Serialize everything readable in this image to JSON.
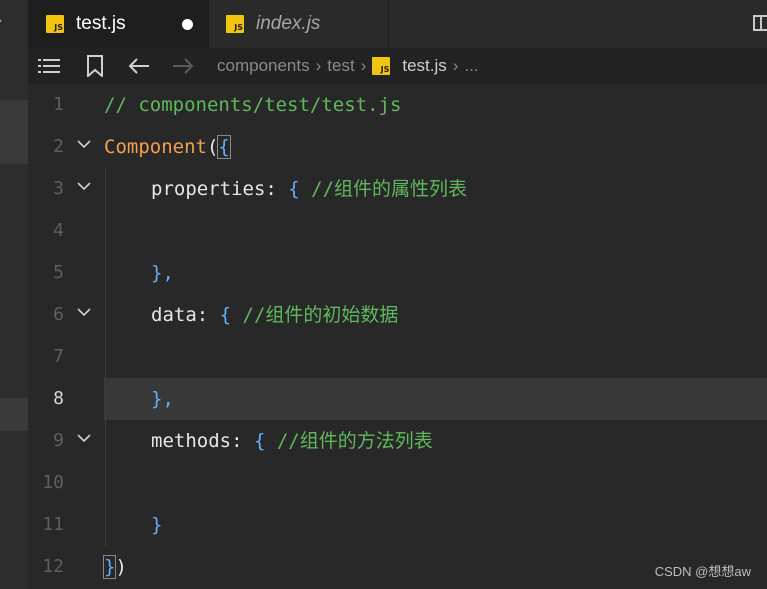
{
  "tabs": [
    {
      "label": "test.js",
      "icon": "js-file-icon",
      "icon_text": "JS",
      "active": true,
      "dirty": true
    },
    {
      "label": "index.js",
      "icon": "js-file-icon",
      "icon_text": "JS",
      "active": false,
      "preview": true
    }
  ],
  "breadcrumb": {
    "items": [
      "components",
      "test"
    ],
    "file_icon_text": "JS",
    "file": "test.js",
    "ellipsis": "..."
  },
  "editor": {
    "current_line": 8,
    "lines": [
      {
        "num": "1",
        "fold": false
      },
      {
        "num": "2",
        "fold": true
      },
      {
        "num": "3",
        "fold": true
      },
      {
        "num": "4",
        "fold": false
      },
      {
        "num": "5",
        "fold": false
      },
      {
        "num": "6",
        "fold": true
      },
      {
        "num": "7",
        "fold": false
      },
      {
        "num": "8",
        "fold": false
      },
      {
        "num": "9",
        "fold": true
      },
      {
        "num": "10",
        "fold": false
      },
      {
        "num": "11",
        "fold": false
      },
      {
        "num": "12",
        "fold": false
      }
    ],
    "tokens": {
      "l1_comment": "// components/test/test.js",
      "l2_func": "Component",
      "l2_paren": "(",
      "l2_brace": "{",
      "l3_key": "properties",
      "l3_colon": ": ",
      "l3_brace": "{",
      "l3_comment": " //组件的属性列表",
      "l5_close": "},",
      "l6_key": "data",
      "l6_colon": ": ",
      "l6_brace": "{",
      "l6_comment": " //组件的初始数据",
      "l8_close": "},",
      "l9_key": "methods",
      "l9_colon": ": ",
      "l9_brace": "{",
      "l9_comment": " //组件的方法列表",
      "l11_close": "}",
      "l12_brace": "}",
      "l12_paren": ")"
    }
  },
  "colors": {
    "background": "#282828",
    "comment": "#5fb85c",
    "function": "#f0a050",
    "brace": "#5fb0ff",
    "js_icon": "#f1c40f"
  },
  "watermark": "CSDN @想想aw"
}
